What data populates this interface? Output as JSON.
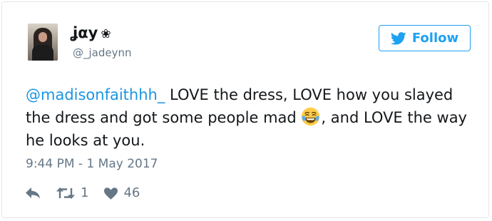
{
  "user": {
    "name": "ʝαу",
    "name_symbol": "❀",
    "handle": "@_jadeynn"
  },
  "follow_button": {
    "label": "Follow",
    "icon": "twitter-bird-icon",
    "color": "#1da1f2"
  },
  "tweet": {
    "mention": "@madisonfaithhh_",
    "text_part1": " LOVE the dress, LOVE how you slayed the dress and got some people mad ",
    "emoji": "face-with-tears-of-joy-emoji",
    "text_part2": ", and LOVE the way he looks at you.",
    "timestamp": "9:44 PM - 1 May 2017"
  },
  "actions": {
    "reply_icon": "reply-icon",
    "retweet_icon": "retweet-icon",
    "retweet_count": "1",
    "like_icon": "heart-icon",
    "like_count": "46"
  },
  "colors": {
    "text": "#14171a",
    "secondary": "#657786",
    "link": "#1b95e0",
    "border": "#e1e8ed"
  }
}
